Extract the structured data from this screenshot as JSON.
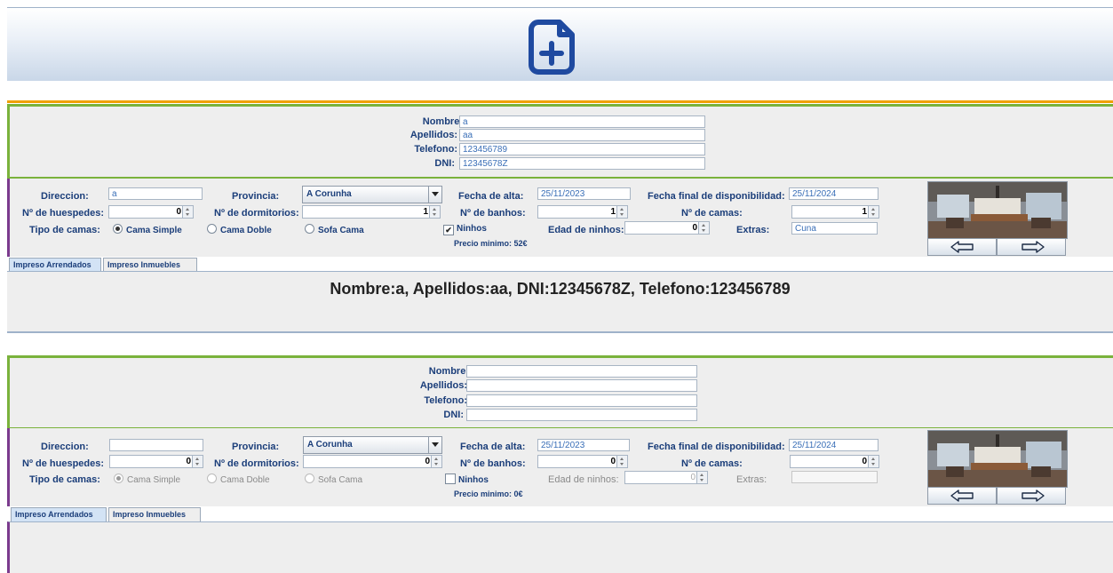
{
  "header": {
    "icon": "add-document-icon"
  },
  "colors": {
    "accent_orange": "#f0a000",
    "accent_green": "#7ab23c",
    "accent_purple": "#7b3b8e",
    "label_blue": "#1b3e7a"
  },
  "labels": {
    "nombre": "Nombre:",
    "apellidos": "Apellidos:",
    "telefono": "Telefono:",
    "dni": "DNI:",
    "direccion": "Direccion:",
    "provincia": "Provincia:",
    "fecha_alta": "Fecha de alta:",
    "fecha_final": "Fecha final de disponibilidad:",
    "huespedes": "Nº de huespedes:",
    "dormitorios": "Nº de dormitorios:",
    "banhos": "Nº de banhos:",
    "camas": "Nº de camas:",
    "tipo_camas": "Tipo de camas:",
    "cama_simple": "Cama Simple",
    "cama_doble": "Cama Doble",
    "sofa_cama": "Sofa Cama",
    "ninhos": "Ninhos",
    "edad_ninhos": "Edad de ninhos:",
    "extras": "Extras:",
    "tab_arrendados": "Impreso Arrendados",
    "tab_inmuebles": "Impreso Inmuebles"
  },
  "form1": {
    "person": {
      "nombre": "a",
      "apellidos": "aa",
      "telefono": "123456789",
      "dni": "12345678Z"
    },
    "property": {
      "direccion": "a",
      "provincia": "A Corunha",
      "fecha_alta": "25/11/2023",
      "fecha_final": "25/11/2024",
      "huespedes": "0",
      "dormitorios": "1",
      "banhos": "1",
      "camas": "1",
      "tipo_cama_selected": "Cama Simple",
      "ninhos_checked": true,
      "ninhos_mark": "✔",
      "edad_ninhos": "0",
      "extras": "Cuna",
      "precio": "Precio minimo: 52€"
    },
    "impreso": "Nombre:a, Apellidos:aa, DNI:12345678Z, Telefono:123456789"
  },
  "form2": {
    "person": {
      "nombre": "",
      "apellidos": "",
      "telefono": "",
      "dni": ""
    },
    "property": {
      "direccion": "",
      "provincia": "A Corunha",
      "fecha_alta": "25/11/2023",
      "fecha_final": "25/11/2024",
      "huespedes": "0",
      "dormitorios": "0",
      "banhos": "0",
      "camas": "0",
      "tipo_cama_selected": "Cama Simple",
      "ninhos_checked": false,
      "ninhos_mark": "",
      "edad_ninhos": "0",
      "extras": "",
      "precio": "Precio minimo: 0€"
    },
    "impreso": ""
  }
}
